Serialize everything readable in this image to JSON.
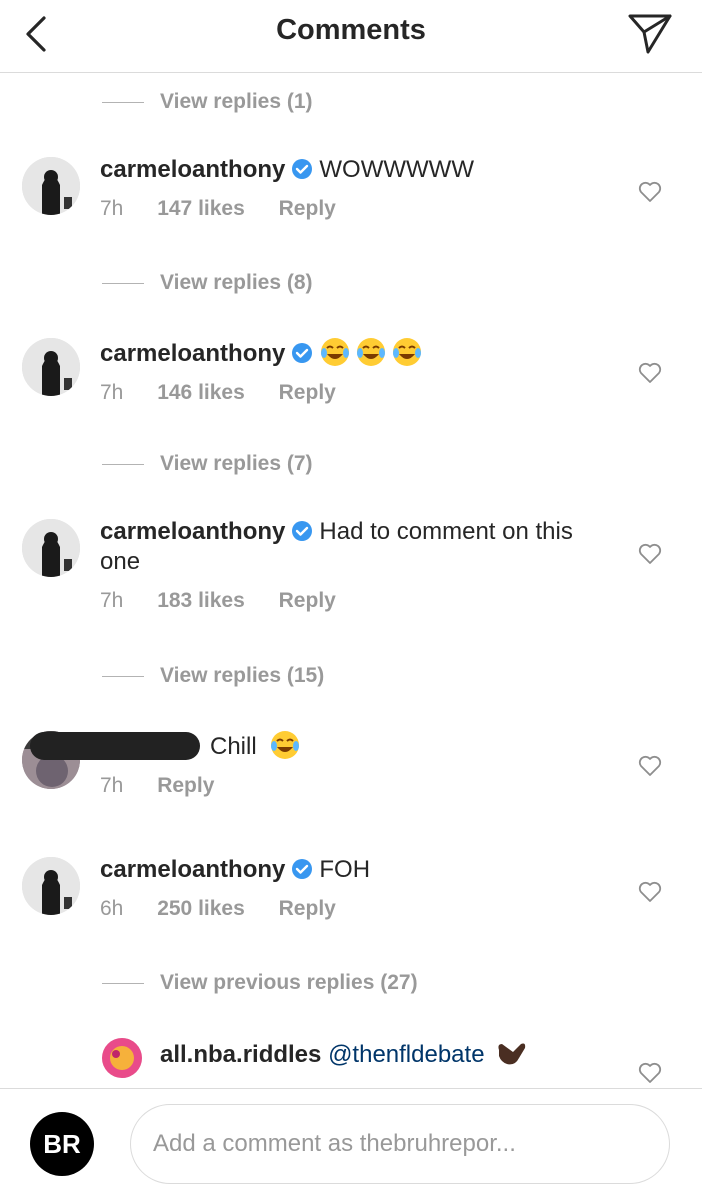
{
  "header": {
    "title": "Comments"
  },
  "view_replies": [
    "View replies (1)",
    "View replies (8)",
    "View replies (7)",
    "View replies (15)",
    "View previous replies (27)"
  ],
  "comments": [
    {
      "username": "carmeloanthony",
      "verified": true,
      "text": "WOWWWWW",
      "time": "7h",
      "likes": "147 likes",
      "reply": "Reply"
    },
    {
      "username": "carmeloanthony",
      "verified": true,
      "text": "",
      "emoji": "face-with-tears-of-joy x3",
      "time": "7h",
      "likes": "146 likes",
      "reply": "Reply"
    },
    {
      "username": "carmeloanthony",
      "verified": true,
      "text": "Had to comment on this one",
      "time": "7h",
      "likes": "183 likes",
      "reply": "Reply"
    },
    {
      "username": "",
      "redacted": true,
      "text": "Chill",
      "emoji": "face-with-tears-of-joy",
      "time": "7h",
      "reply": "Reply"
    },
    {
      "username": "carmeloanthony",
      "verified": true,
      "text": "FOH",
      "time": "6h",
      "likes": "250 likes",
      "reply": "Reply"
    },
    {
      "username": "all.nba.riddles",
      "mention": "@thenfldebate",
      "emoji": "call-me-hand"
    }
  ],
  "footer": {
    "logo_text": "BR",
    "input_placeholder": "Add a comment as thebruhrepor..."
  },
  "colors": {
    "verified": "#3897f0",
    "muted": "#999999",
    "text": "#262626",
    "mention": "#003569"
  }
}
